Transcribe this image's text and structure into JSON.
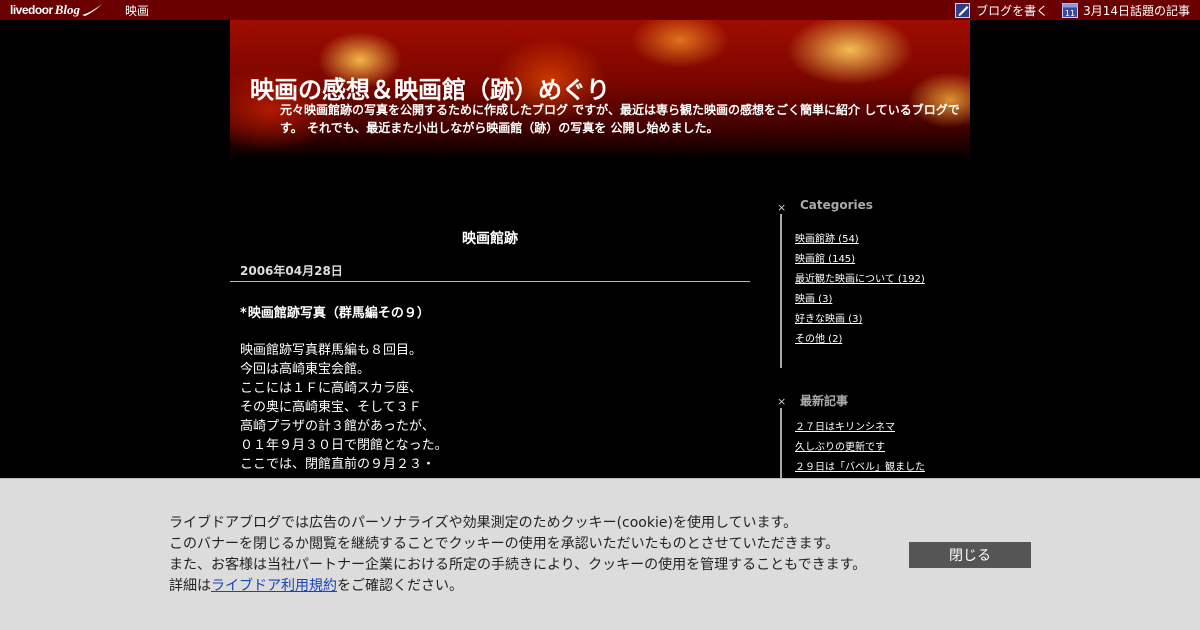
{
  "topbar": {
    "logo_livedoor": "livedoor",
    "logo_blog": "Blog",
    "nav_link": "映画",
    "write_blog": "ブログを書く",
    "topic_articles": "3月14日話題の記事",
    "calendar_day": "11"
  },
  "header": {
    "title": "映画の感想＆映画館（跡）めぐり",
    "description": "元々映画館跡の写真を公開するために作成したブログ ですが、最近は専ら観た映画の感想をごく簡単に紹介 しているブログです。 それでも、最近また小出しながら映画館（跡）の写真を 公開し始めました。"
  },
  "main": {
    "category_title": "映画館跡",
    "date": "2006年04月28日",
    "entry_title_star": "*",
    "entry_title": "映画館跡写真（群馬編その９）",
    "body_lines": [
      "映画館跡写真群馬編も８回目。",
      "今回は高崎東宝会館。",
      "ここには１Ｆに高崎スカラ座、",
      "その奥に高崎東宝、そして３Ｆ",
      "高崎プラザの計３館があったが、",
      "０１年９月３０日で閉館となった。",
      "ここでは、閉館直前の９月２３・"
    ]
  },
  "sidebar": {
    "categories": {
      "mark": "×",
      "heading": "Categories",
      "items": [
        "映画館跡 (54)",
        "映画館 (145)",
        "最近観た映画について (192)",
        "映画 (3)",
        "好きな映画 (3)",
        "その他 (2)"
      ]
    },
    "recent": {
      "mark": "×",
      "heading": "最新記事",
      "items": [
        "２７日はキリンシネマ",
        "久しぶりの更新です",
        "２９日は「バベル」観ました"
      ]
    }
  },
  "cookie": {
    "line1": "ライブドアブログでは広告のパーソナライズや効果測定のためクッキー(cookie)を使用しています。",
    "line2": "このバナーを閉じるか閲覧を継続することでクッキーの使用を承認いただいたものとさせていただきます。",
    "line3": "また、お客様は当社パートナー企業における所定の手続きにより、クッキーの使用を管理することもできます。",
    "line4_prefix": "詳細は",
    "line4_link": "ライブドア利用規約",
    "line4_suffix": "をご確認ください。",
    "close_label": "閉じる"
  },
  "colors": {
    "topbar_bg": "#6a0000",
    "page_bg": "#000000",
    "banner_bg": "#dcdcdc",
    "close_button_bg": "#555555",
    "link_blue": "#1a45b8"
  }
}
